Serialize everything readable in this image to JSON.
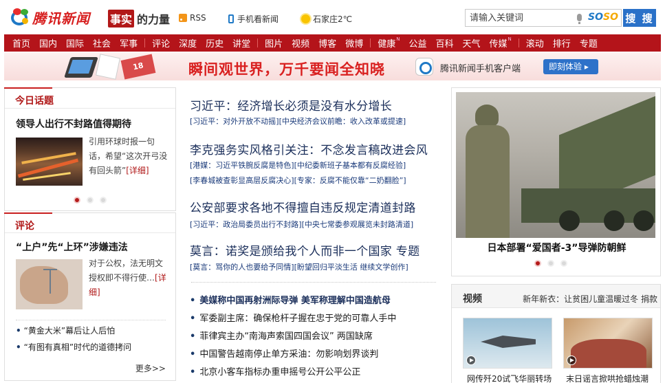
{
  "header": {
    "logo_text": "腾讯新闻",
    "shishi_box": "事实",
    "shishi_text": "的力量",
    "rss": "RSS",
    "mobile": "手机看新闻",
    "weather": "石家庄2℃",
    "search_placeholder": "请输入关键词",
    "soso_a": "SO",
    "soso_b": "SO",
    "search_button": "搜 搜"
  },
  "nav": {
    "groups": [
      [
        "首页",
        "国内",
        "国际",
        "社会",
        "军事"
      ],
      [
        "评论",
        "深度",
        "历史",
        "讲堂"
      ],
      [
        "图片",
        "视频",
        "博客",
        "微博"
      ],
      [
        "健康",
        "公益",
        "百科",
        "天气",
        "传媒"
      ],
      [
        "滚动",
        "排行",
        "专题"
      ]
    ],
    "sup_new": "N"
  },
  "banner": {
    "tag": "18",
    "slogan": "瞬间观世界，万千要闻全知晓",
    "app_text": "腾讯新闻手机客户端",
    "button": "即刻体验 ▸"
  },
  "left": {
    "today": {
      "title": "今日话题",
      "headline": "领导人出行不封路值得期待",
      "summary": "引用环球时报一句话，希望“这次开弓没有回头箭”",
      "more": "[详细]"
    },
    "comment": {
      "title": "评论",
      "headline": "“上户”先“上环”涉嫌违法",
      "summary": "对于公权，法无明文授权即不得行使…",
      "more": "[详细]",
      "items": [
        "“黄金大米”幕后让人后怕",
        "“有图有真相”时代的道德拷问"
      ],
      "more_link": "更多>>"
    }
  },
  "center": {
    "blocks": [
      {
        "headline": "习近平：经济增长必须是没有水分增长",
        "sublines": [
          "[习近平：对外开放不动摇][中央经济会议前瞻：收入改革或提速]"
        ]
      },
      {
        "headline": "李克强务实风格引关注：不念发言稿改进会风",
        "sublines": [
          "[港媒：习近平铁腕反腐是特色][中纪委新班子基本都有反腐经验]",
          "[李春城被查彰显高层反腐决心][专家：反腐不能仅靠“二奶翻脸”]"
        ]
      },
      {
        "headline": "公安部要求各地不得擅自违反规定清道封路",
        "sublines": [
          "[习近平：政治局委员出行不封路][中央七常委参观展览未封路清道]"
        ]
      },
      {
        "headline": "莫言：诺奖是颁给我个人而非一个国家 专题",
        "sublines": [
          "[莫言：骂你的人也要给予同情][盼望回归平淡生活 继续文学创作]"
        ]
      }
    ],
    "news": [
      "美媒称中国再射洲际导弹 美军称理解中国造航母",
      "军委副主席：确保枪杆子握在忠于党的可靠人手中",
      "菲律宾主办“南海声索国四国会议” 两国缺席",
      "中国警告越南停止单方采油：勿影响划界谈判",
      "北京小客车指标办重申摇号公开公平公正"
    ]
  },
  "right": {
    "focus_caption": "日本部署“爱国者-3”导弹防朝鲜",
    "video_title": "视频",
    "video_link": "新年新衣：让贫困儿童温暖过冬 捐款",
    "videos": [
      "网传歼20试飞华丽转场",
      "末日谣言掀哄抢蜡烛潮"
    ]
  },
  "colors": {
    "nav_red": "#b4141a",
    "brand_red": "#d71f1f",
    "search_blue": "#2a71c8",
    "link_navy": "#1a2e5a"
  }
}
